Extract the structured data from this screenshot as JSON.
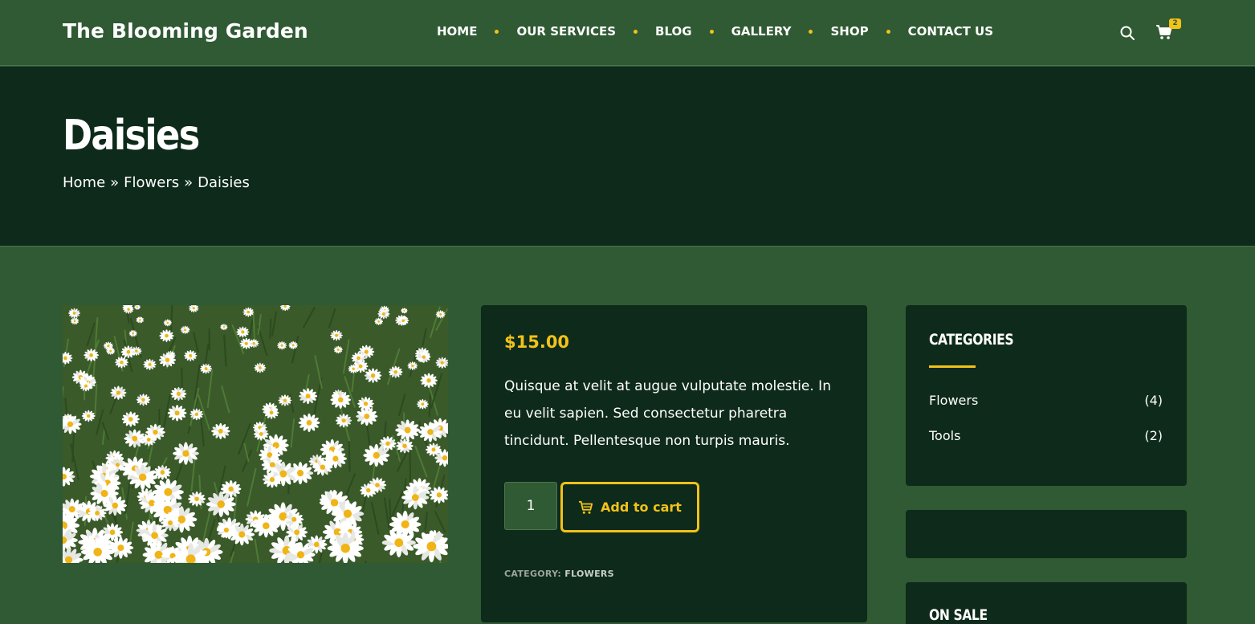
{
  "header": {
    "site_title": "The Blooming Garden",
    "nav": [
      {
        "label": "HOME"
      },
      {
        "label": "OUR SERVICES"
      },
      {
        "label": "BLOG"
      },
      {
        "label": "GALLERY"
      },
      {
        "label": "SHOP"
      },
      {
        "label": "CONTACT US"
      }
    ],
    "cart_count": "2",
    "icons": [
      "search-icon",
      "cart-icon"
    ]
  },
  "hero": {
    "title": "Daisies",
    "breadcrumb": [
      "Home",
      "Flowers",
      "Daisies"
    ],
    "separator": "»"
  },
  "product": {
    "image_alt": "",
    "price": "$15.00",
    "description": "Quisque at velit at augue vulputate molestie. In eu velit sapien. Sed consectetur pharetra tincidunt. Pellentesque non turpis mauris.",
    "quantity": "1",
    "add_to_cart_label": "Add to cart",
    "meta_label": "CATEGORY:",
    "meta_value": "FLOWERS"
  },
  "sidebar": {
    "categories_title": "CATEGORIES",
    "categories": [
      {
        "name": "Flowers",
        "count": "(4)"
      },
      {
        "name": "Tools",
        "count": "(2)"
      }
    ],
    "on_sale_title": "ON SALE"
  },
  "colors": {
    "header_bg": "#2f5a33",
    "hero_bg": "#0e2a1a",
    "accent": "#f2c21a",
    "text": "#ffffff"
  }
}
